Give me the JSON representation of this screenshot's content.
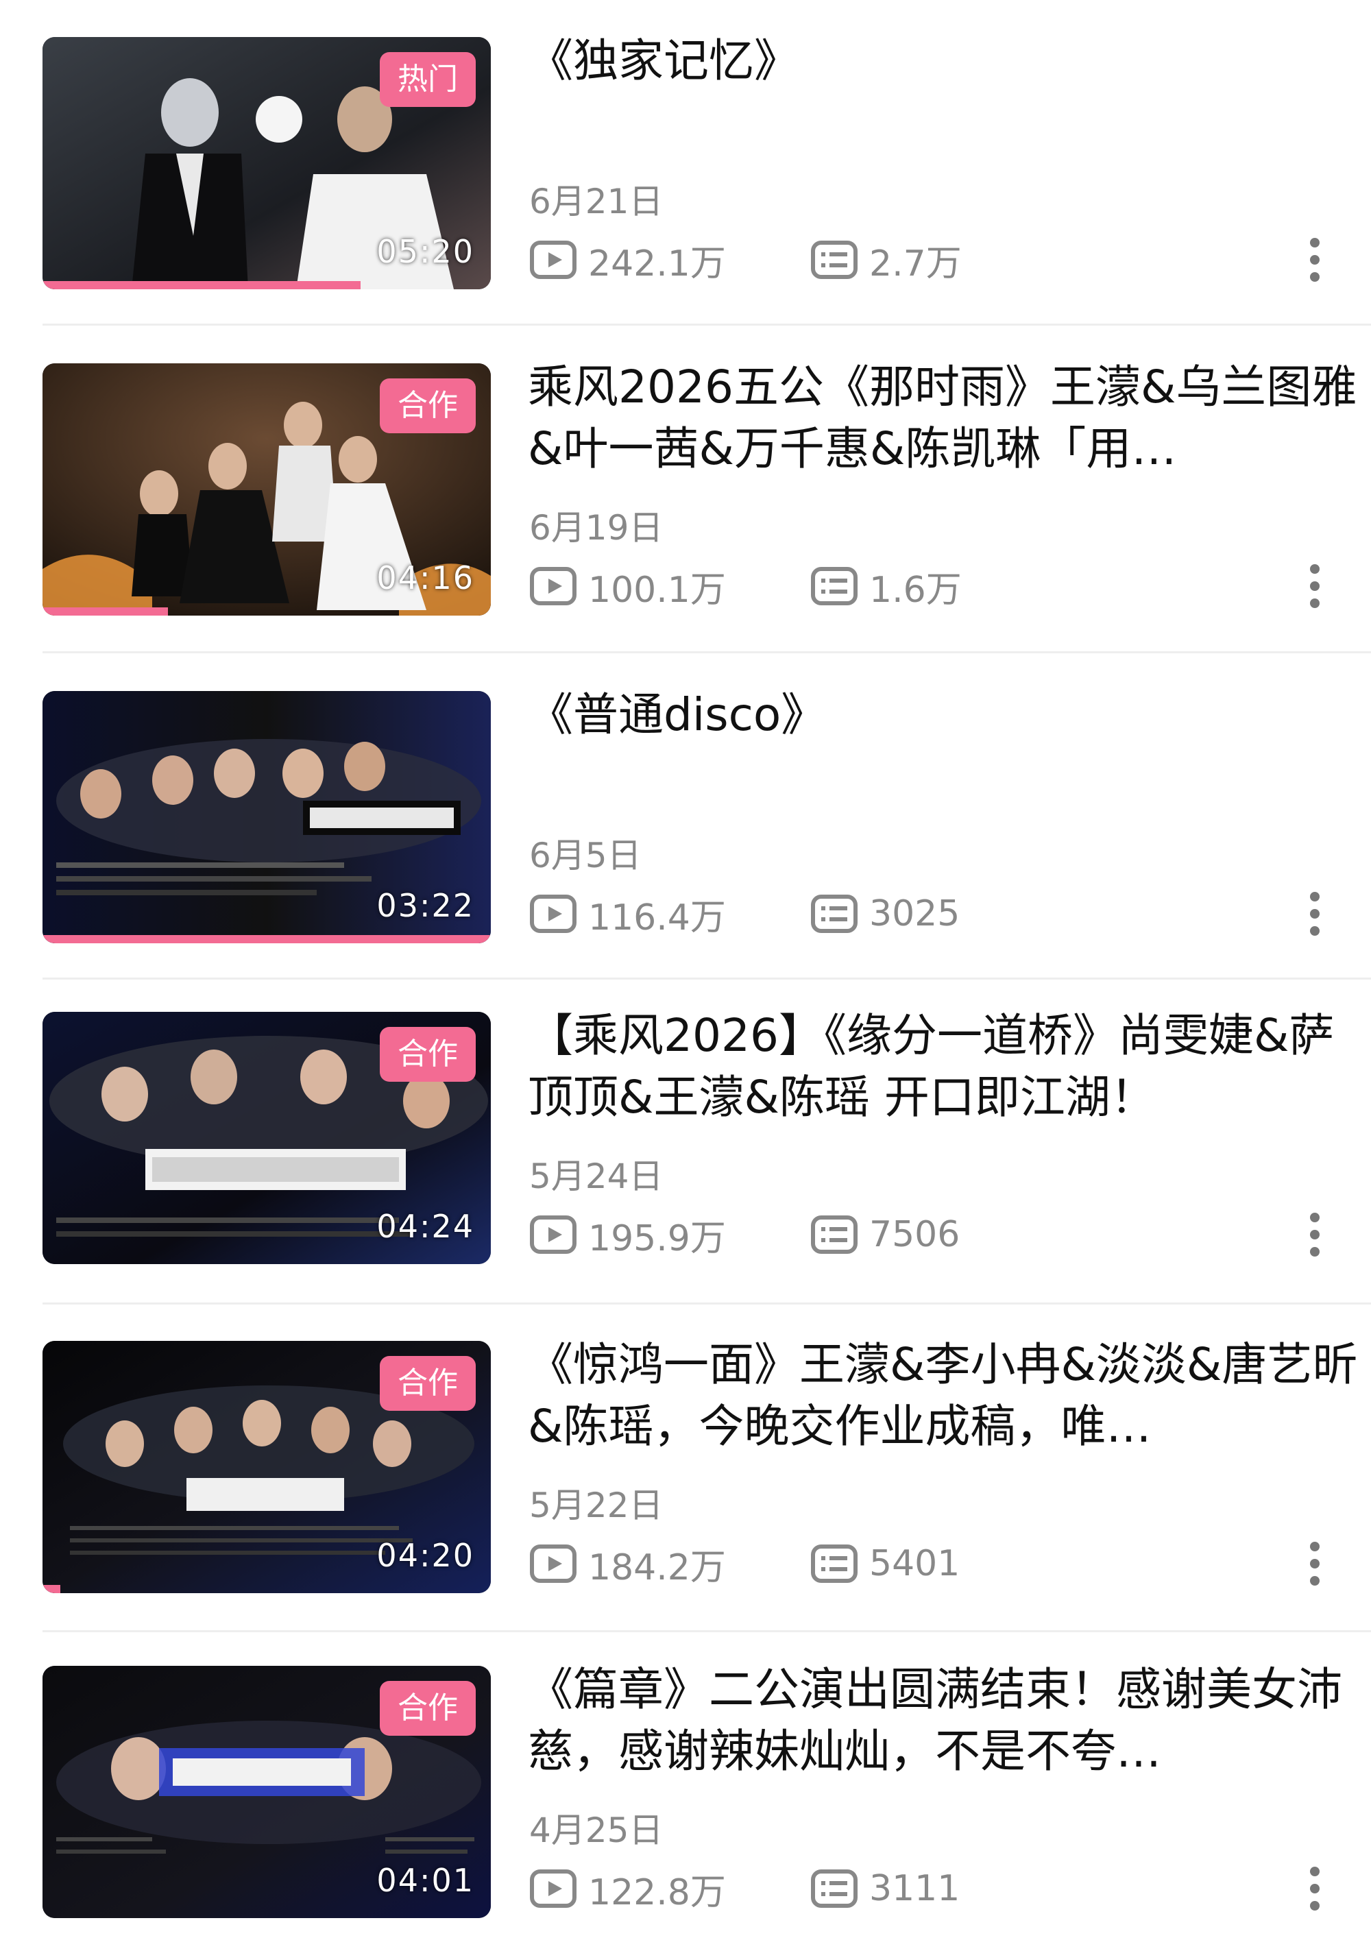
{
  "videos": [
    {
      "title": "《独家记忆》",
      "badge": "热门",
      "duration": "05:20",
      "progress": 0.71,
      "date": "6月21日",
      "plays": "242.1万",
      "comments": "2.7万"
    },
    {
      "title": "乘风2026五公《那时雨》王濛&乌兰图雅&叶一茜&万千惠&陈凯琳「用…",
      "badge": "合作",
      "duration": "04:16",
      "progress": 0.28,
      "date": "6月19日",
      "plays": "100.1万",
      "comments": "1.6万"
    },
    {
      "title": "《普通disco》",
      "badge": "",
      "duration": "03:22",
      "progress": 1.0,
      "date": "6月5日",
      "plays": "116.4万",
      "comments": "3025"
    },
    {
      "title": "【乘风2026】《缘分一道桥》尚雯婕&萨顶顶&王濛&陈瑶 开口即江湖！",
      "badge": "合作",
      "duration": "04:24",
      "progress": 0.0,
      "date": "5月24日",
      "plays": "195.9万",
      "comments": "7506"
    },
    {
      "title": "《惊鸿一面》王濛&李小冉&淡淡&唐艺昕&陈瑶，今晚交作业成稿，唯…",
      "badge": "合作",
      "duration": "04:20",
      "progress": 0.04,
      "date": "5月22日",
      "plays": "184.2万",
      "comments": "5401"
    },
    {
      "title": "《篇章》二公演出圆满结束！感谢美女沛慈，感谢辣妹灿灿，不是不夸…",
      "badge": "合作",
      "duration": "04:01",
      "progress": 0.0,
      "date": "4月25日",
      "plays": "122.8万",
      "comments": "3111"
    }
  ],
  "colors": {
    "accent": "#f36b93",
    "meta_text": "#888888",
    "title_text": "#111111",
    "divider": "#eeeeee"
  },
  "icons": {
    "play_count": "play-count-icon",
    "comment_count": "comment-count-icon",
    "more": "more-vertical-icon"
  }
}
